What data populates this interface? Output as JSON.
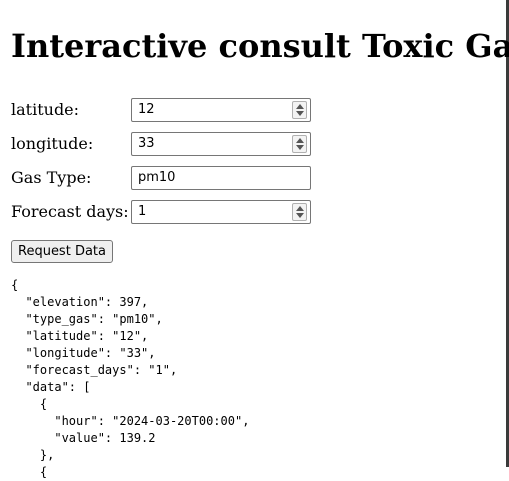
{
  "page": {
    "title": "Interactive consult Toxic Gas"
  },
  "form": {
    "latitude": {
      "label": "latitude:",
      "value": "12"
    },
    "longitude": {
      "label": "longitude:",
      "value": "33"
    },
    "gas_type": {
      "label": "Gas Type:",
      "value": "pm10"
    },
    "forecast_days": {
      "label": "Forecast days:",
      "value": "1"
    },
    "submit_label": "Request Data"
  },
  "output": {
    "lines": [
      "{",
      "  \"elevation\": 397,",
      "  \"type_gas\": \"pm10\",",
      "  \"latitude\": \"12\",",
      "  \"longitude\": \"33\",",
      "  \"forecast_days\": \"1\",",
      "  \"data\": [",
      "    {",
      "      \"hour\": \"2024-03-20T00:00\",",
      "      \"value\": 139.2",
      "    },",
      "    {"
    ]
  }
}
